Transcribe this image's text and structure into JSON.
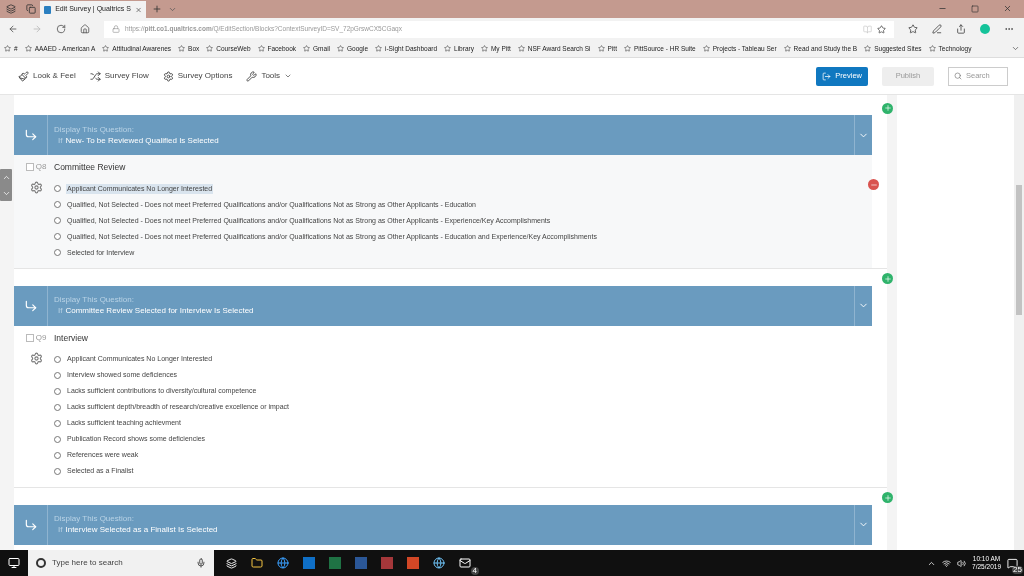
{
  "browser": {
    "tab": {
      "title": "Edit Survey | Qualtrics S",
      "selected": true
    },
    "address": "https://**pitt.co1.qualtrics.com**/Q/EditSection/Blocks?ContextSurveyID=SV_72pGrswCX5CGaqx",
    "bookmarks": [
      "#",
      "AAAED - American A",
      "Attitudinal Awarenes",
      "Box",
      "CourseWeb",
      "Facebook",
      "Gmail",
      "Google",
      "i-Sight  Dashboard",
      "Library",
      "My Pitt",
      "NSF Award Search Si",
      "Pitt",
      "PittSource - HR Suite",
      "Projects - Tableau Ser",
      "Read and Study the B",
      "Suggested Sites",
      "Technology"
    ]
  },
  "toolbar": {
    "items": [
      {
        "kind": "brush",
        "label": "Look & Feel"
      },
      {
        "kind": "flow",
        "label": "Survey Flow"
      },
      {
        "kind": "gear",
        "label": "Survey Options"
      },
      {
        "kind": "wrench",
        "label": "Tools"
      }
    ],
    "preview": "Preview",
    "publish": {
      "label": "Publish",
      "disabled": true
    },
    "search": {
      "placeholder": "Search"
    }
  },
  "blocks": [
    {
      "display_logic": {
        "heading": "Display This Question:",
        "if_word": "If",
        "condition": "New- To be Reviewed Qualified Is Selected"
      },
      "question": {
        "number": "Q8",
        "checked": false,
        "selected": true,
        "title": "Committee Review",
        "options": [
          {
            "label": "Applicant Communicates No Longer Interested",
            "highlighted": true
          },
          {
            "label": "Qualified, Not Selected - Does not meet Preferred Qualifications and/or Qualifications Not as Strong as Other Applicants - Education",
            "highlighted": false
          },
          {
            "label": "Qualified, Not Selected - Does not meet Preferred Qualifications and/or Qualifications Not as Strong as Other Applicants - Experience/Key Accomplishments",
            "highlighted": false
          },
          {
            "label": "Qualified, Not Selected - Does not meet Preferred Qualifications and/or Qualifications Not as Strong as Other Applicants - Education and Experience/Key Accomplishments",
            "highlighted": false
          },
          {
            "label": "Selected for Interview",
            "highlighted": false
          }
        ]
      }
    },
    {
      "display_logic": {
        "heading": "Display This Question:",
        "if_word": "If",
        "condition": "Committee Review Selected for Interview Is Selected"
      },
      "question": {
        "number": "Q9",
        "checked": false,
        "selected": false,
        "title": "Interview",
        "options": [
          {
            "label": "Applicant Communicates No Longer Interested",
            "highlighted": false
          },
          {
            "label": "Interview showed some deficiences",
            "highlighted": false
          },
          {
            "label": "Lacks sufficient contributions to diversity/cultural competence",
            "highlighted": false
          },
          {
            "label": "Lacks sufficient depth/breadth of research/creative excellence or impact",
            "highlighted": false
          },
          {
            "label": "Lacks sufficient teaching achievment",
            "highlighted": false
          },
          {
            "label": "Publication Record shows some deficiencies",
            "highlighted": false
          },
          {
            "label": "References were weak",
            "highlighted": false
          },
          {
            "label": "Selected as a Finalist",
            "highlighted": false
          }
        ]
      }
    },
    {
      "display_logic": {
        "heading": "Display This Question:",
        "if_word": "If",
        "condition": "Interview Selected as a Finalist Is Selected"
      }
    }
  ],
  "taskbar": {
    "search_placeholder": "Type here to search",
    "mail_badge": "4",
    "time": "10:10 AM",
    "date": "7/25/2019",
    "notifications": "25"
  }
}
